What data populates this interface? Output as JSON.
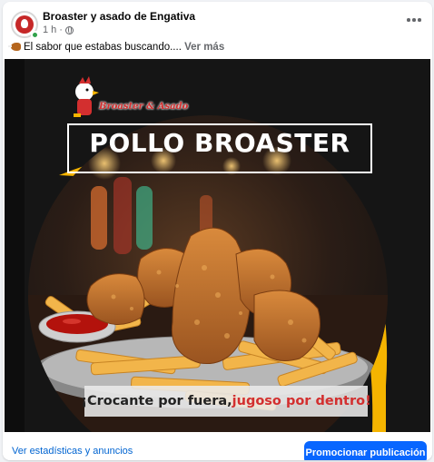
{
  "post": {
    "page_name": "Broaster y asado de Engativa",
    "time": "1 h",
    "separator": "·",
    "caption": "El sabor que estabas buscando.... ",
    "see_more": "Ver más"
  },
  "image": {
    "logo_text": "Broaster & Asado",
    "headline": "POLLO BROASTER",
    "tagline_white": "¡Crocante por fuera,",
    "tagline_red": " jugoso por dentro!"
  },
  "footer": {
    "stats_link": "Ver estadísticas y anuncios",
    "promote_button": "Promocionar publicación"
  },
  "colors": {
    "accent_blue": "#0866ff",
    "link_blue": "#0064d1",
    "yellow_arc": "#f5b400",
    "tagline_red": "#d32f2f"
  }
}
